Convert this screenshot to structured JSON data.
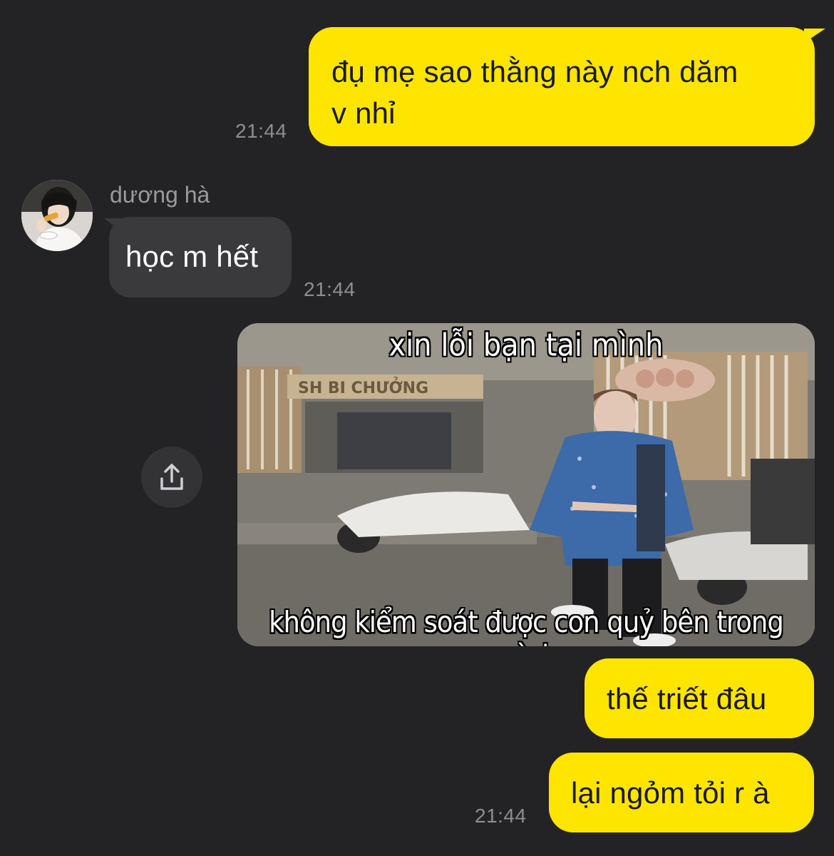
{
  "messages": {
    "m1": {
      "text": "đụ mẹ sao thằng này nch dăm v nhỉ",
      "line1": "đụ mẹ sao thằng này nch dăm",
      "line2": "v nhỉ",
      "time": "21:44"
    },
    "m2": {
      "sender": "dương hà",
      "text": "học m hết",
      "time": "21:44"
    },
    "m3": {
      "caption_top": "xin lỗi bạn tại mình",
      "caption_bottom": "không kiểm soát được con quỷ bên trong mình",
      "sign_text": "SH BI CHƯỞNG"
    },
    "m4": {
      "text": "thế triết đâu"
    },
    "m5": {
      "text": "lại ngỏm tỏi r à",
      "time": "21:44"
    }
  },
  "icons": {
    "share": "share-icon",
    "avatar": "avatar"
  },
  "colors": {
    "background": "#232325",
    "mine_bubble": "#FEE500",
    "theirs_bubble": "#3a3a3c",
    "timestamp": "#8e8e92"
  }
}
